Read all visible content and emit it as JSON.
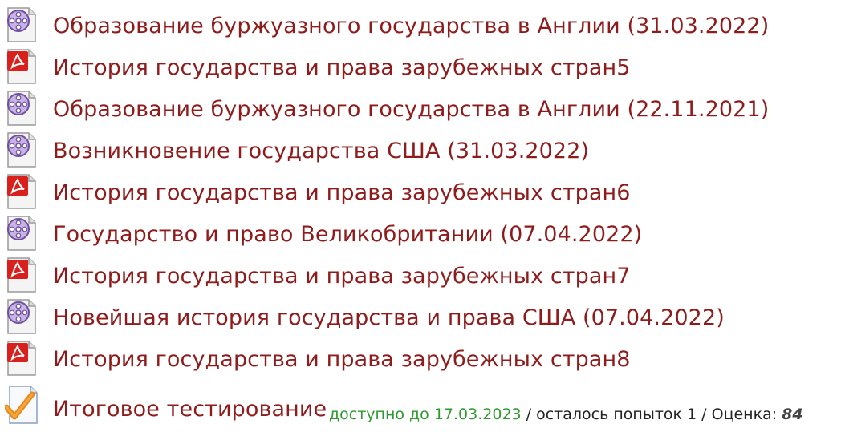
{
  "items": [
    {
      "type": "video",
      "icon": "video-file-icon",
      "label": "Образование буржуазного государства в Англии (31.03.2022)"
    },
    {
      "type": "pdf",
      "icon": "pdf-file-icon",
      "label": "История государства и права зарубежных стран5"
    },
    {
      "type": "video",
      "icon": "video-file-icon",
      "label": "Образование буржуазного государства в Англии (22.11.2021)"
    },
    {
      "type": "video",
      "icon": "video-file-icon",
      "label": "Возникновение государства США (31.03.2022)"
    },
    {
      "type": "pdf",
      "icon": "pdf-file-icon",
      "label": "История государства и права зарубежных стран6"
    },
    {
      "type": "video",
      "icon": "video-file-icon",
      "label": "Государство и право Великобритании (07.04.2022)"
    },
    {
      "type": "pdf",
      "icon": "pdf-file-icon",
      "label": "История государства и права зарубежных стран7"
    },
    {
      "type": "video",
      "icon": "video-file-icon",
      "label": "Новейшая история государства и права США (07.04.2022)"
    },
    {
      "type": "pdf",
      "icon": "pdf-file-icon",
      "label": "История государства и права зарубежных стран8"
    }
  ],
  "quiz": {
    "icon": "quiz-checkmark-icon",
    "label": "Итоговое тестирование",
    "availability": "доступно до 17.03.2023",
    "separator1": " / ",
    "attempts": "осталось попыток 1",
    "separator2": " / ",
    "grade_label": "Оценка: ",
    "grade_value": "84"
  },
  "colors": {
    "link": "#8f1c1c",
    "available": "#2e9b2e"
  }
}
